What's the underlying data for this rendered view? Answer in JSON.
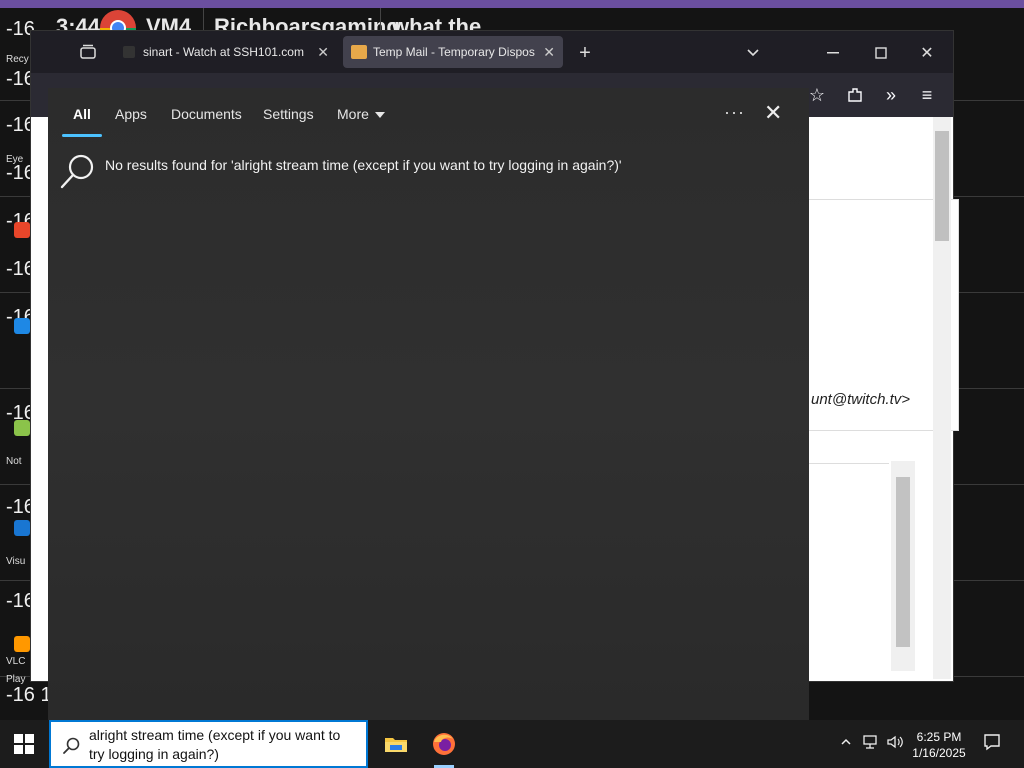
{
  "background": {
    "titles": [
      "3:44",
      "VM4",
      "Richboarsgaming",
      "what the"
    ],
    "desktop_numbers": [
      "-16",
      "-16",
      "-16",
      "-16",
      "-16",
      "-16",
      "-16",
      "-16",
      "-16",
      "-16",
      "-16 1"
    ],
    "desktop_labels": [
      "Recy",
      "Eye",
      "Not",
      "Visu",
      "VLC",
      "Play"
    ]
  },
  "browser": {
    "tabs": [
      {
        "label": "sinart - Watch at SSH101.com",
        "active": false
      },
      {
        "label": "Temp Mail - Temporary Dispos",
        "active": true
      }
    ],
    "new_tab_symbol": "+",
    "email_fragment": "unt@twitch.tv>"
  },
  "search_panel": {
    "tabs": [
      "All",
      "Apps",
      "Documents",
      "Settings",
      "More"
    ],
    "active_tab": "All",
    "ellipsis": "···",
    "close_symbol": "✕",
    "no_results_text": "No results found for 'alright stream time (except if you want to try logging in again?)'"
  },
  "taskbar": {
    "search_query": "alright stream time (except if you want to try logging in again?)",
    "time": "6:25 PM",
    "date": "1/16/2025"
  },
  "colors": {
    "accent": "#4cc2ff",
    "search_border": "#0078d4",
    "panel_bg": "#2e2e2e",
    "browser_bg": "#1f1e25"
  }
}
